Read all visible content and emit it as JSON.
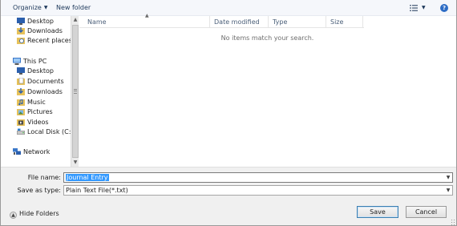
{
  "toolbar": {
    "organize_label": "Organize",
    "new_folder_label": "New folder",
    "view_icon": "view-options-icon",
    "help_icon": "help-icon"
  },
  "nav": {
    "items": [
      {
        "label": "Desktop",
        "icon": "desktop-icon"
      },
      {
        "label": "Downloads",
        "icon": "downloads-icon"
      },
      {
        "label": "Recent places",
        "icon": "recent-places-icon"
      },
      {
        "label": "This PC",
        "icon": "this-pc-icon"
      },
      {
        "label": "Desktop",
        "icon": "desktop-icon"
      },
      {
        "label": "Documents",
        "icon": "documents-icon"
      },
      {
        "label": "Downloads",
        "icon": "downloads-icon"
      },
      {
        "label": "Music",
        "icon": "music-icon"
      },
      {
        "label": "Pictures",
        "icon": "pictures-icon"
      },
      {
        "label": "Videos",
        "icon": "videos-icon"
      },
      {
        "label": "Local Disk (C:)",
        "icon": "local-disk-icon"
      },
      {
        "label": "Network",
        "icon": "network-icon"
      }
    ]
  },
  "filelist": {
    "columns": [
      "Name",
      "Date modified",
      "Type",
      "Size"
    ],
    "empty_message": "No items match your search."
  },
  "bottom": {
    "file_name_label": "File name:",
    "file_name_value": "Journal Entry",
    "save_type_label": "Save as type:",
    "save_type_value": "Plain Text File(*.txt)",
    "hide_folders_label": "Hide Folders",
    "save_label": "Save",
    "cancel_label": "Cancel"
  },
  "colors": {
    "accent": "#3399ff",
    "toolbar_text": "#1e395b",
    "column_header_text": "#4c607a"
  }
}
